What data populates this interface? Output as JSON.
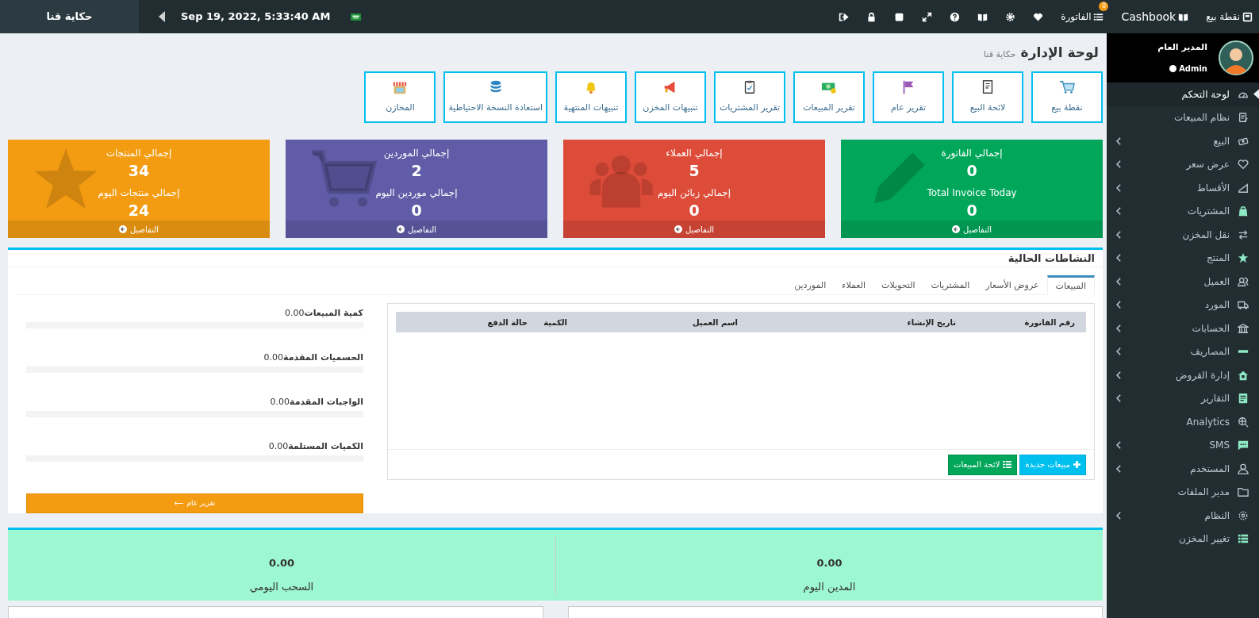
{
  "topbar": {
    "brand": "حكاية قنا",
    "datetime": "Sep 19, 2022, 5:33:40 AM",
    "links": [
      {
        "label": "نقطة بيع"
      },
      {
        "label": "Cashbook"
      },
      {
        "label": "الفاتورة",
        "badge": "0"
      }
    ]
  },
  "sidebar": {
    "user": {
      "name": "المدير العام",
      "role": "Admin",
      "online": true
    },
    "items": [
      {
        "label": "لوحة التحكم",
        "selected": true,
        "expandable": false
      },
      {
        "label": "نظام المبيعات",
        "selected": false,
        "expandable": false
      },
      {
        "label": "البيع",
        "selected": false,
        "expandable": true
      },
      {
        "label": "عرض سعر",
        "selected": false,
        "expandable": true
      },
      {
        "label": "الأقساط",
        "selected": false,
        "expandable": true
      },
      {
        "label": "المشتريات",
        "selected": false,
        "expandable": true
      },
      {
        "label": "نقل المخزن",
        "selected": false,
        "expandable": true
      },
      {
        "label": "المنتج",
        "selected": false,
        "expandable": true
      },
      {
        "label": "العميل",
        "selected": false,
        "expandable": true
      },
      {
        "label": "المورد",
        "selected": false,
        "expandable": true
      },
      {
        "label": "الحسابات",
        "selected": false,
        "expandable": true
      },
      {
        "label": "المصاريف",
        "selected": false,
        "expandable": true
      },
      {
        "label": "إدارة القروض",
        "selected": false,
        "expandable": true
      },
      {
        "label": "التقارير",
        "selected": false,
        "expandable": true
      },
      {
        "label": "Analytics",
        "selected": false,
        "expandable": false
      },
      {
        "label": "SMS",
        "selected": false,
        "expandable": true
      },
      {
        "label": "المستخدم",
        "selected": false,
        "expandable": true
      },
      {
        "label": "مدير الملفات",
        "selected": false,
        "expandable": false
      },
      {
        "label": "النظام",
        "selected": false,
        "expandable": true
      },
      {
        "label": "تغيير المخزن",
        "selected": false,
        "expandable": false
      }
    ]
  },
  "page": {
    "title": "لوحة الإدارة",
    "subtitle": "حكاية قنا"
  },
  "shortcuts": [
    {
      "label": "نقطة بيع"
    },
    {
      "label": "لائحة البيع"
    },
    {
      "label": "تقرير عام"
    },
    {
      "label": "تقرير المبيعات"
    },
    {
      "label": "تقرير المشتريات"
    },
    {
      "label": "تنبيهات المخزن"
    },
    {
      "label": "تنبيهات المنتهية"
    },
    {
      "label": "استعادة النسخة الاحتياطية"
    },
    {
      "label": "المخازن"
    }
  ],
  "stat_cards": [
    {
      "color": "#00a65a",
      "label_1": "إجمالي الفاتورة",
      "value_1": "0",
      "label_2": "Total Invoice Today",
      "value_2": "0",
      "footer": "التفاصيل"
    },
    {
      "color": "#dd4b39",
      "label_1": "إجمالي العملاء",
      "value_1": "5",
      "label_2": "إجمالي زبائن اليوم",
      "value_2": "0",
      "footer": "التفاصيل"
    },
    {
      "color": "#605ca8",
      "label_1": "إجمالي الموردين",
      "value_1": "2",
      "label_2": "إجمالي موردين اليوم",
      "value_2": "0",
      "footer": "التفاصيل"
    },
    {
      "color": "#f39c12",
      "label_1": "إجمالي المنتجات",
      "value_1": "34",
      "label_2": "إجمالي منتجات اليوم",
      "value_2": "24",
      "footer": "التفاصيل"
    }
  ],
  "activities": {
    "title": "النشاطات الحالية",
    "tabs": [
      {
        "label": "المبيعات",
        "selected": true
      },
      {
        "label": "عروض الأسعار",
        "selected": false
      },
      {
        "label": "المشتريات",
        "selected": false
      },
      {
        "label": "التحويلات",
        "selected": false
      },
      {
        "label": "العملاء",
        "selected": false
      },
      {
        "label": "الموردين",
        "selected": false
      }
    ],
    "table": {
      "columns": [
        "رقم الفاتورة",
        "تاريخ الإنشاء",
        "اسم العميل",
        "الكمية",
        "حالة الدفع"
      ]
    },
    "buttons": [
      {
        "kind": "new",
        "label": "مبيعات جديدة"
      },
      {
        "kind": "list",
        "label": "لائحة المبيعات"
      }
    ],
    "metrics": [
      {
        "label": "كمية المبيعات",
        "value": "0.00",
        "level": 0
      },
      {
        "label": "الحسميات المقدمة",
        "value": "0.00",
        "level": 0
      },
      {
        "label": "الواجبات المقدمة",
        "value": "0.00",
        "level": 0
      },
      {
        "label": "الكميات المستلمة",
        "value": "0.00",
        "level": 0
      }
    ],
    "report_button": "تقرير عام"
  },
  "daily_summary": [
    {
      "value": "0.00",
      "label": "المدين اليوم"
    },
    {
      "value": "0.00",
      "label": "السحب اليومي"
    }
  ]
}
